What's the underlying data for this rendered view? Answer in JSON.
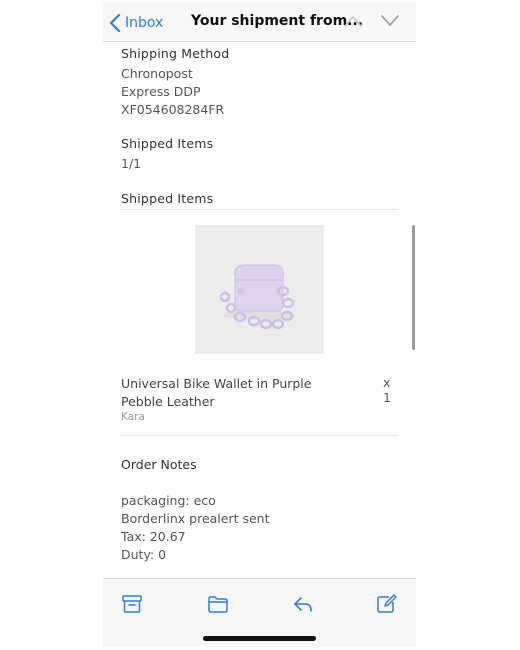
{
  "navbar": {
    "back_label": "Inbox",
    "title": "Your shipment from..."
  },
  "shipping": {
    "method_title": "Shipping Method",
    "lines": [
      "Chronopost",
      "Express DDP",
      "XF054608284FR"
    ]
  },
  "shipped_count": {
    "title": "Shipped Items",
    "value": "1/1"
  },
  "shipped_items": {
    "title": "Shipped Items",
    "item": {
      "name": "Universal Bike Wallet in Purple Pebble Leather",
      "quantity": "x 1",
      "brand": "Kara"
    }
  },
  "order_notes": {
    "title": "Order Notes",
    "lines": [
      "packaging: eco",
      "Borderlinx prealert sent",
      "Tax: 20.67",
      "Duty: 0"
    ]
  },
  "toolbar": {
    "icons": [
      "archive-icon",
      "folder-icon",
      "reply-icon",
      "compose-icon"
    ]
  },
  "colors": {
    "accent": "#2f7ed8",
    "bar_background": "#f7f7f7",
    "product_purple": "#d9d2ec"
  }
}
